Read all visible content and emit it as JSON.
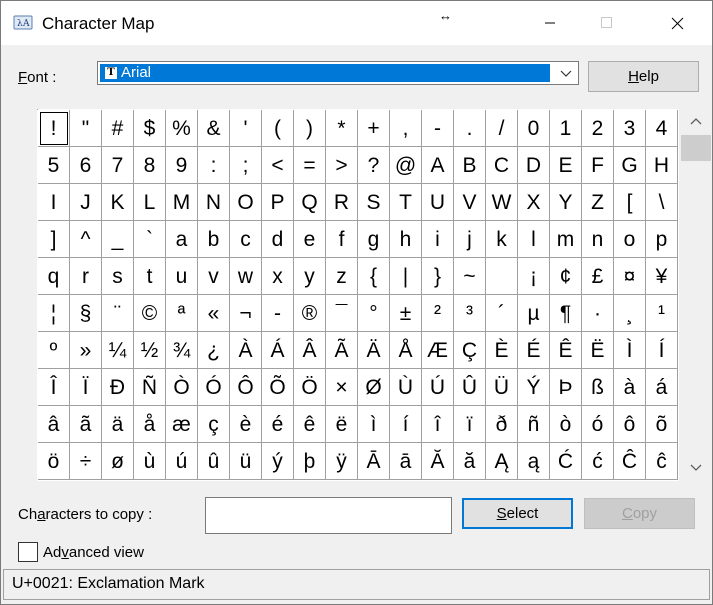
{
  "window": {
    "title": "Character Map"
  },
  "font": {
    "label_pre": "",
    "label_u": "F",
    "label_post": "ont :",
    "selected": "Arial"
  },
  "help_button": {
    "label_u": "H",
    "label_post": "elp"
  },
  "grid": {
    "columns": 20,
    "rows": 10,
    "selected_index": 0,
    "characters": [
      "!",
      "\"",
      "#",
      "$",
      "%",
      "&",
      "'",
      "(",
      ")",
      "*",
      "+",
      ",",
      "-",
      ".",
      "/",
      "0",
      "1",
      "2",
      "3",
      "4",
      "5",
      "6",
      "7",
      "8",
      "9",
      ":",
      ";",
      "<",
      "=",
      ">",
      "?",
      "@",
      "A",
      "B",
      "C",
      "D",
      "E",
      "F",
      "G",
      "H",
      "I",
      "J",
      "K",
      "L",
      "M",
      "N",
      "O",
      "P",
      "Q",
      "R",
      "S",
      "T",
      "U",
      "V",
      "W",
      "X",
      "Y",
      "Z",
      "[",
      "\\",
      "]",
      "^",
      "_",
      "`",
      "a",
      "b",
      "c",
      "d",
      "e",
      "f",
      "g",
      "h",
      "i",
      "j",
      "k",
      "l",
      "m",
      "n",
      "o",
      "p",
      "q",
      "r",
      "s",
      "t",
      "u",
      "v",
      "w",
      "x",
      "y",
      "z",
      "{",
      "|",
      "}",
      "~",
      " ",
      "¡",
      "¢",
      "£",
      "¤",
      "¥",
      "¦",
      "§",
      "¨",
      "©",
      "ª",
      "«",
      "¬",
      "-",
      "®",
      "¯",
      "°",
      "±",
      "²",
      "³",
      "´",
      "µ",
      "¶",
      "·",
      "¸",
      "¹",
      "º",
      "»",
      "¼",
      "½",
      "¾",
      "¿",
      "À",
      "Á",
      "Â",
      "Ã",
      "Ä",
      "Å",
      "Æ",
      "Ç",
      "È",
      "É",
      "Ê",
      "Ë",
      "Ì",
      "Í",
      "Î",
      "Ï",
      "Ð",
      "Ñ",
      "Ò",
      "Ó",
      "Ô",
      "Õ",
      "Ö",
      "×",
      "Ø",
      "Ù",
      "Ú",
      "Û",
      "Ü",
      "Ý",
      "Þ",
      "ß",
      "à",
      "á",
      "â",
      "ã",
      "ä",
      "å",
      "æ",
      "ç",
      "è",
      "é",
      "ê",
      "ë",
      "ì",
      "í",
      "î",
      "ï",
      "ð",
      "ñ",
      "ò",
      "ó",
      "ô",
      "õ",
      "ö",
      "÷",
      "ø",
      "ù",
      "ú",
      "û",
      "ü",
      "ý",
      "þ",
      "ÿ",
      "Ā",
      "ā",
      "Ă",
      "ă",
      "Ą",
      "ą",
      "Ć",
      "ć",
      "Ĉ",
      "ĉ"
    ]
  },
  "copy": {
    "label_pre": "Ch",
    "label_u": "a",
    "label_post": "racters to copy :",
    "value": ""
  },
  "select_button": {
    "label_u": "S",
    "label_post": "elect"
  },
  "copy_button": {
    "label_u": "C",
    "label_post": "opy"
  },
  "advanced": {
    "label_pre": "Ad",
    "label_u": "v",
    "label_post": "anced view",
    "checked": false
  },
  "status": {
    "text": "U+0021: Exclamation Mark"
  }
}
